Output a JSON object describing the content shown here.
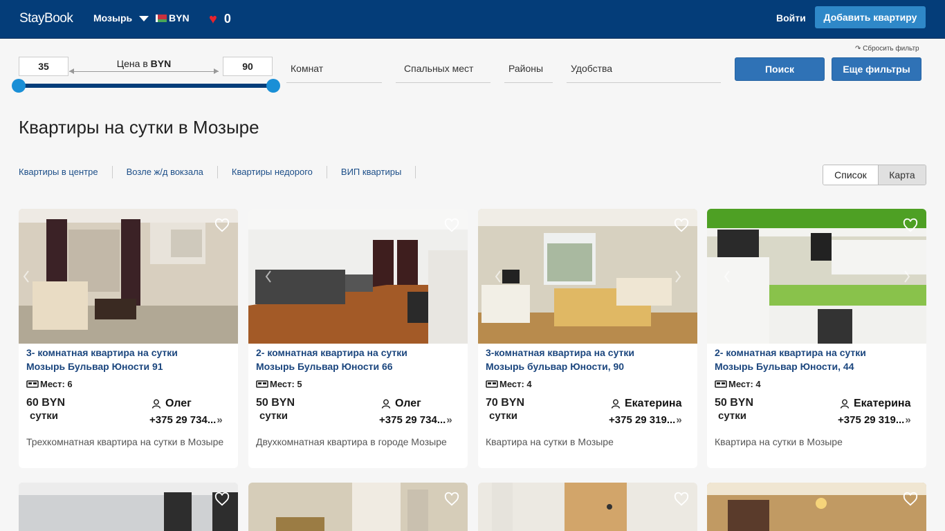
{
  "header": {
    "logo": "StayBook",
    "city": "Мозырь",
    "currency": "BYN",
    "favorites_count": "0",
    "login": "Войти",
    "add_apartment": "Добавить квартиру"
  },
  "filters": {
    "reset": "↷ Сбросить фильтр",
    "price_min": "35",
    "price_max": "90",
    "price_label_prefix": "Цена в",
    "price_label_currency": "BYN",
    "rooms": "Комнат",
    "beds": "Спальных мест",
    "districts": "Районы",
    "amenities": "Удобства",
    "search": "Поиск",
    "more_filters": "Еще фильтры"
  },
  "page_title": "Квартиры на сутки в Мозыре",
  "quick_links": [
    "Квартиры в центре",
    "Возле ж/д вокзала",
    "Квартиры недорого",
    "ВИП квартиры"
  ],
  "view_toggle": {
    "list": "Список",
    "map": "Карта"
  },
  "listings": [
    {
      "title1": "3- комнатная квартира на сутки",
      "title2": "Мозырь Бульвар Юности 91",
      "places": "Мест: 6",
      "price": "60 BYN",
      "per": "сутки",
      "owner": "Олег",
      "phone": "+375 29 734...",
      "desc": "Трехкомнатная квартира на сутки в Мозыре"
    },
    {
      "title1": "2- комнатная квартира на сутки",
      "title2": "Мозырь Бульвар Юности 66",
      "places": "Мест: 5",
      "price": "50 BYN",
      "per": "сутки",
      "owner": "Олег",
      "phone": "+375 29 734...",
      "desc": "Двухкомнатная квартира в городе Мозыре"
    },
    {
      "title1": "3-комнатная квартира на сутки",
      "title2": "Мозырь бульвар Юности, 90",
      "places": "Мест: 4",
      "price": "70 BYN",
      "per": "сутки",
      "owner": "Екатерина",
      "phone": "+375 29 319...",
      "desc": "Квартира на сутки в Мозыре"
    },
    {
      "title1": "2- комнатная квартира на сутки",
      "title2": "Мозырь Бульвар Юности, 44",
      "places": "Мест: 4",
      "price": "50 BYN",
      "per": "сутки",
      "owner": "Екатерина",
      "phone": "+375 29 319...",
      "desc": "Квартира на сутки в Мозыре"
    }
  ],
  "colors": {
    "header_bg": "#043d79",
    "accent": "#2f88c8",
    "link": "#1b467e",
    "favorite": "#e8232d"
  },
  "icons": [
    "heart-icon",
    "heart-outline-icon",
    "bed-icon",
    "user-icon",
    "chevron-right-double-icon",
    "caret-down-icon",
    "belarus-flag-icon"
  ]
}
